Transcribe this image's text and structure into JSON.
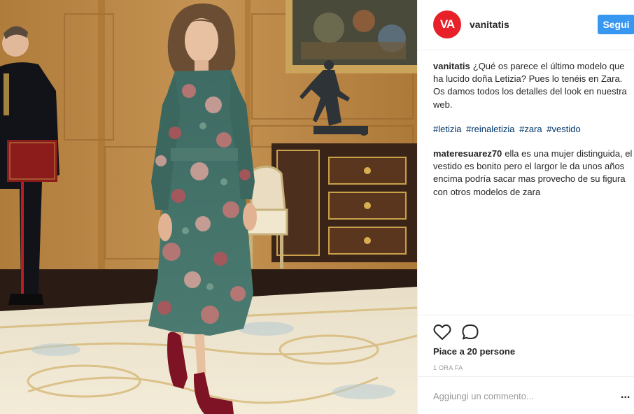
{
  "post": {
    "username": "vanitatis",
    "avatar_text": "VA",
    "follow_label": "Segui",
    "brand_color": "#e8202a",
    "follow_color": "#3897f0",
    "caption": {
      "author": "vanitatis",
      "text": "¿Qué os parece el último modelo que ha lucido doña Letizia? Pues lo tenéis en Zara. Os damos todos los detalles del look en nuestra web."
    },
    "hashtags": [
      "#letizia",
      "#reinaletizia",
      "#zara",
      "#vestido"
    ],
    "comments": [
      {
        "author": "materesuarez70",
        "text": "ella es una mujer distinguida, el vestido es bonito pero el largor le da unos años encima podría sacar mas provecho de su figura con otros modelos de zara"
      }
    ],
    "likes": "Piace a 20 persone",
    "time": "1 ORA FA",
    "add_comment_placeholder": "Aggiungi un commento...",
    "more_label": "...",
    "icons": {
      "like": "heart-icon",
      "comment": "comment-bubble-icon"
    }
  }
}
